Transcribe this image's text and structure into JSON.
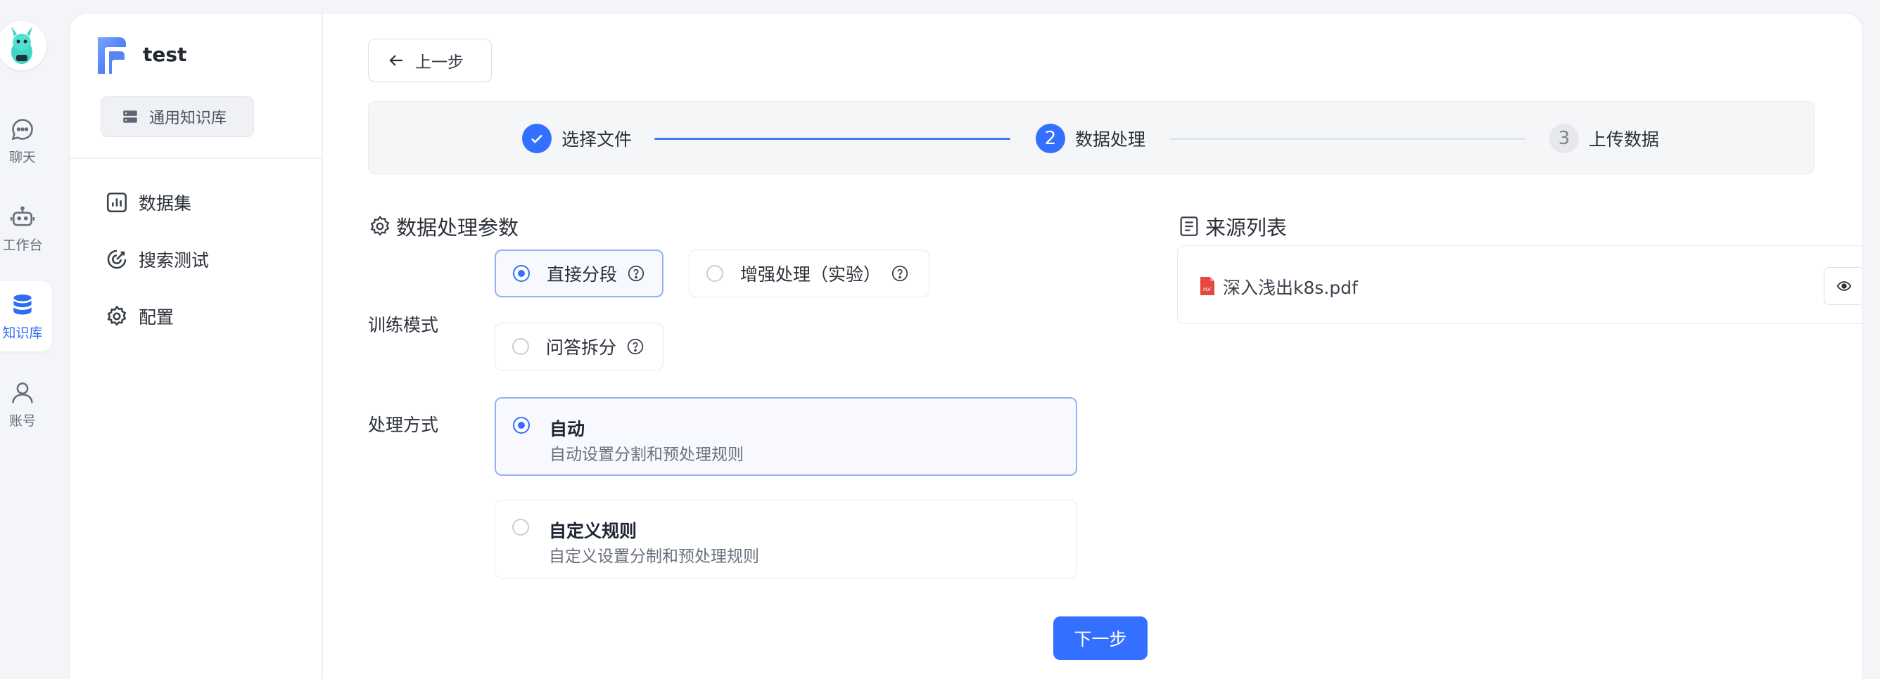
{
  "nav": {
    "items": [
      {
        "label": "聊天",
        "icon": "chat-icon"
      },
      {
        "label": "工作台",
        "icon": "robot-icon"
      },
      {
        "label": "知识库",
        "icon": "database-icon",
        "active": true
      },
      {
        "label": "账号",
        "icon": "user-icon"
      }
    ]
  },
  "sidebar": {
    "kb_name": "test",
    "kb_type": "通用知识库",
    "menu": [
      {
        "label": "数据集",
        "icon": "chart-icon"
      },
      {
        "label": "搜索测试",
        "icon": "target-icon"
      },
      {
        "label": "配置",
        "icon": "gear-icon"
      }
    ]
  },
  "toolbar": {
    "back_label": "上一步"
  },
  "steps": [
    {
      "number": "1",
      "label": "选择文件",
      "status": "done"
    },
    {
      "number": "2",
      "label": "数据处理",
      "status": "active"
    },
    {
      "number": "3",
      "label": "上传数据",
      "status": "todo"
    }
  ],
  "params": {
    "title": "数据处理参数",
    "training_mode_label": "训练模式",
    "training_modes": [
      {
        "label": "直接分段",
        "selected": true
      },
      {
        "label": "增强处理（实验）",
        "selected": false
      },
      {
        "label": "问答拆分",
        "selected": false
      }
    ],
    "process_label": "处理方式",
    "process_modes": [
      {
        "title": "自动",
        "desc": "自动设置分割和预处理规则",
        "selected": true
      },
      {
        "title": "自定义规则",
        "desc": "自定义设置分制和预处理规则",
        "selected": false
      }
    ],
    "next_label": "下一步"
  },
  "sources": {
    "title": "来源列表",
    "files": [
      {
        "name": "深入浅出k8s.pdf",
        "icon": "pdf-icon"
      }
    ]
  },
  "colors": {
    "accent": "#3370ff",
    "active_nav": "#2e6ef5",
    "pdf": "#e5483f"
  }
}
